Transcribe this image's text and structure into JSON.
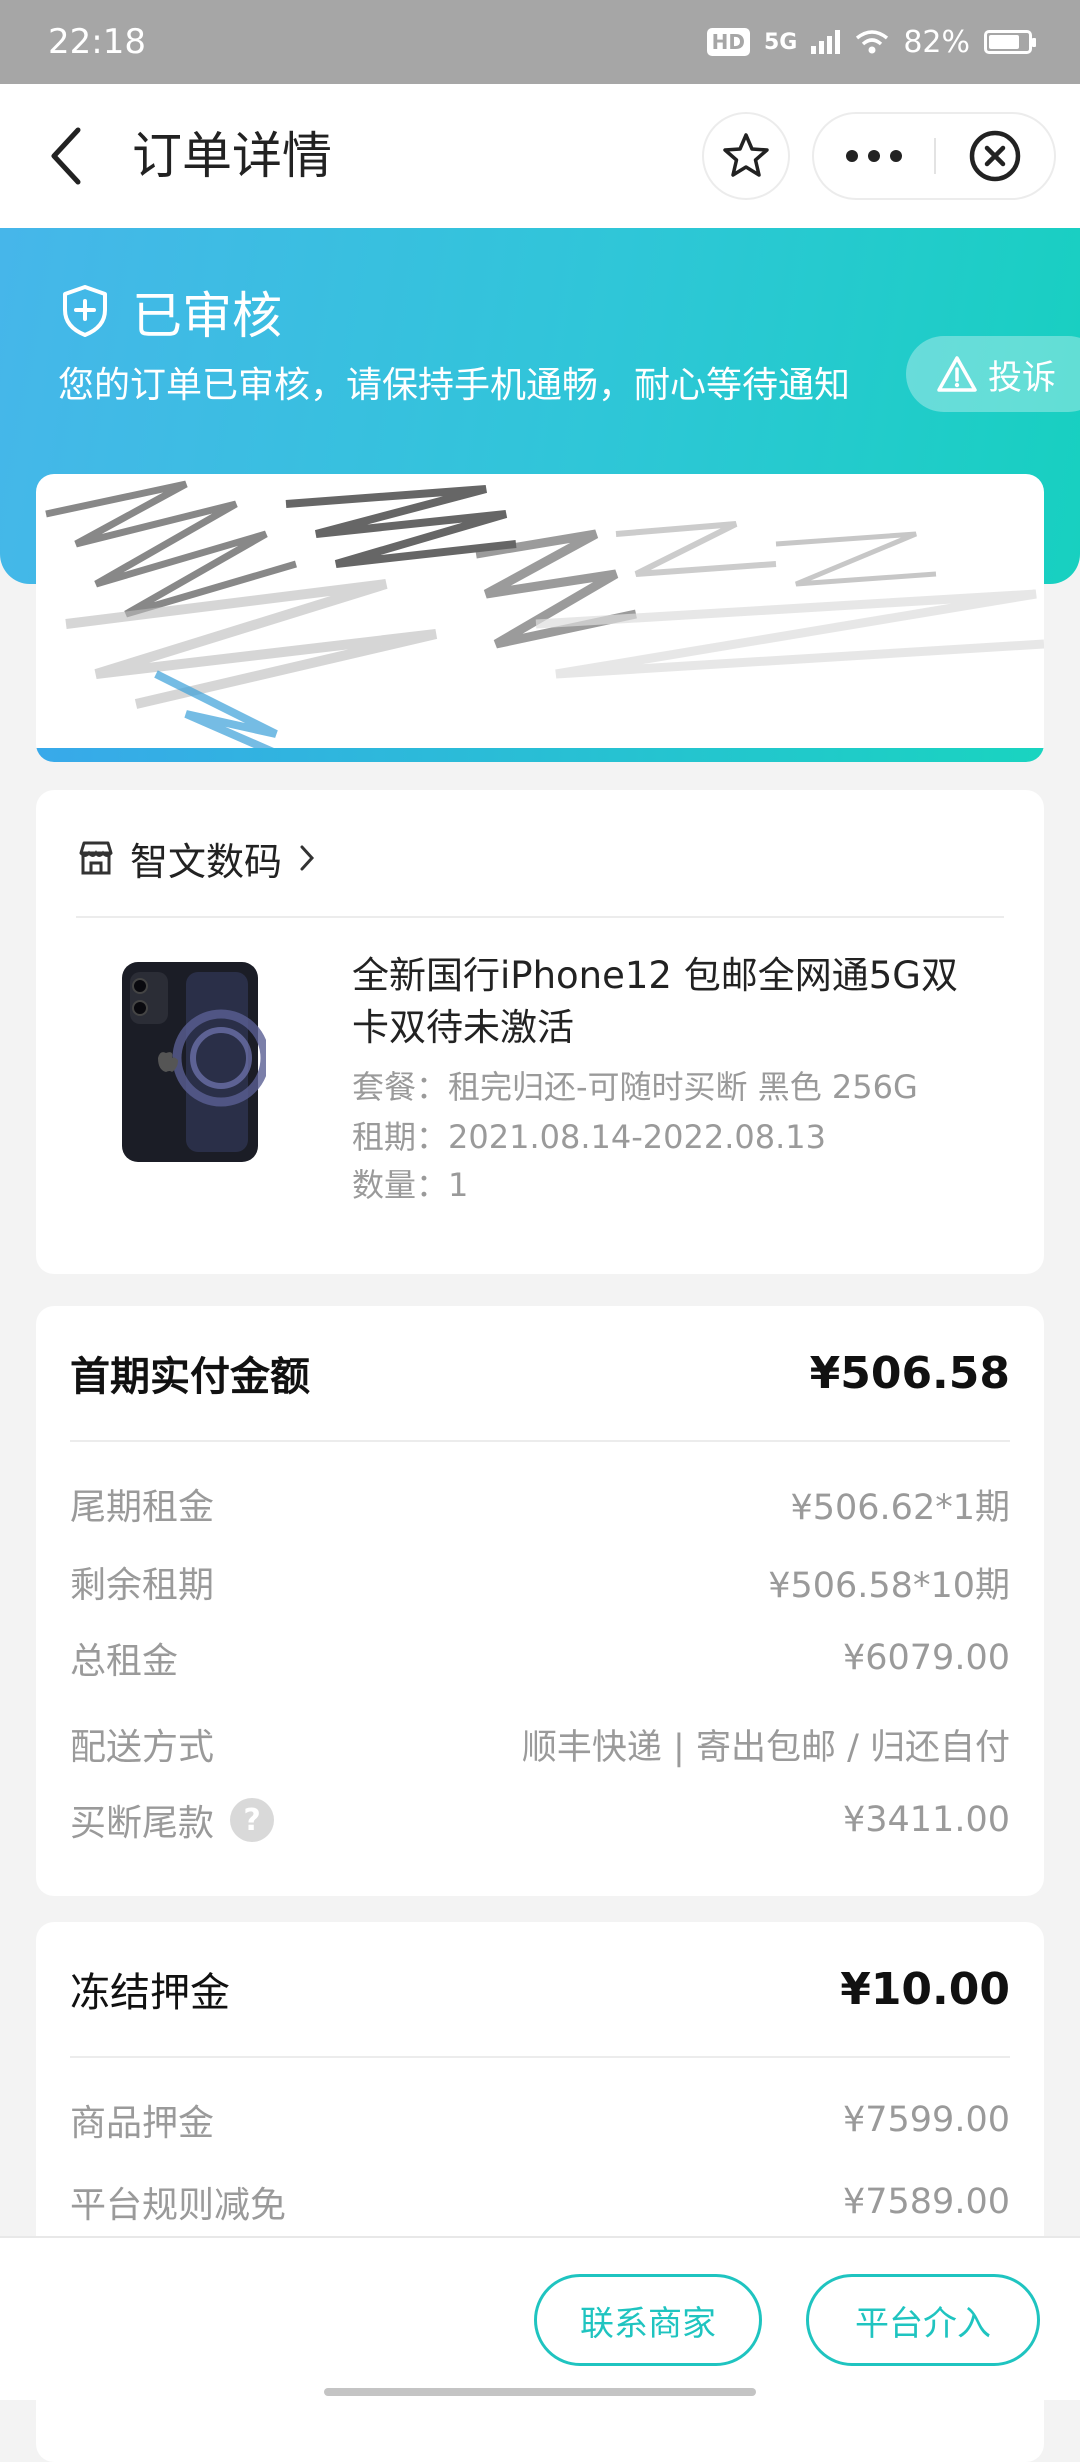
{
  "status_bar": {
    "time": "22:18",
    "hd": "HD",
    "signal": "5G",
    "battery": "82%"
  },
  "header": {
    "title": "订单详情"
  },
  "order_status": {
    "title": "已审核",
    "description": "您的订单已审核，请保持手机通畅，耐心等待通知",
    "complaint_label": "投诉"
  },
  "product": {
    "shop_name": "智文数码",
    "title": "全新国行iPhone12 包邮全网通5G双卡双待未激活",
    "package": "套餐：租完归还-可随时买断 黑色 256G",
    "period": "租期：2021.08.14-2022.08.13",
    "quantity": "数量：1"
  },
  "payment": {
    "head_label": "首期实付金额",
    "head_value": "¥506.58",
    "rows": [
      {
        "label": "尾期租金",
        "value": "¥506.62*1期"
      },
      {
        "label": "剩余租期",
        "value": "¥506.58*10期"
      },
      {
        "label": "总租金",
        "value": "¥6079.00"
      },
      {
        "label": "配送方式",
        "value": "顺丰快递 | 寄出包邮 / 归还自付"
      },
      {
        "label": "买断尾款",
        "value": "¥3411.00"
      }
    ]
  },
  "deposit": {
    "head_label": "冻结押金",
    "head_value": "¥10.00",
    "rows": [
      {
        "label": "商品押金",
        "value": "¥7599.00"
      },
      {
        "label": "平台规则减免",
        "value": "¥7589.00"
      }
    ]
  },
  "bottom": {
    "contact_label": "联系商家",
    "platform_label": "平台介入"
  },
  "colors": {
    "accent": "#1fc4c0",
    "banner_start": "#46b6ea",
    "banner_end": "#17d0c0"
  }
}
